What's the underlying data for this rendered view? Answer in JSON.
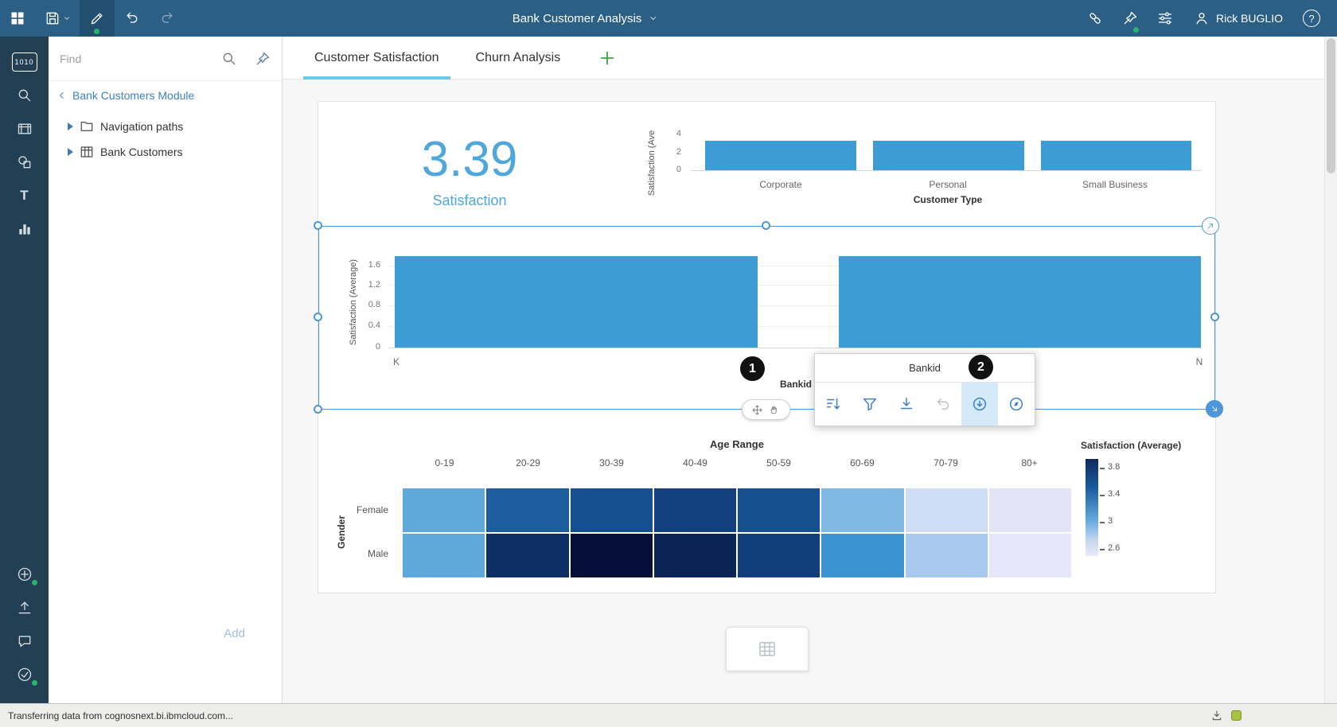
{
  "topbar": {
    "title": "Bank Customer Analysis",
    "user_name": "Rick BUGLIO",
    "help_label": "?"
  },
  "rail": {
    "binary_label": "1010",
    "text_tool_label": "T"
  },
  "panel": {
    "find_placeholder": "Find",
    "breadcrumb": "Bank Customers Module",
    "tree": [
      {
        "label": "Navigation paths"
      },
      {
        "label": "Bank Customers"
      }
    ],
    "add_label": "Add"
  },
  "tabs": {
    "items": [
      {
        "label": "Customer Satisfaction",
        "active": true
      },
      {
        "label": "Churn Analysis",
        "active": false
      }
    ]
  },
  "kpi": {
    "value": "3.39",
    "label": "Satisfaction"
  },
  "callouts": {
    "one": "1",
    "two": "2"
  },
  "popup": {
    "title": "Bankid",
    "tools": [
      "sort",
      "filter",
      "top-bottom",
      "drill-back",
      "drill-down",
      "explore"
    ],
    "active_tool": "drill-down",
    "disabled_tool": "drill-back"
  },
  "statusbar": {
    "text": "Transferring data from cognosnext.bi.ibmcloud.com..."
  },
  "colors": {
    "topbar_bg": "#2C5F86",
    "rail_bg": "#223F54",
    "accent_blue": "#3B7FC6",
    "bar_blue": "#3E9CD4",
    "kpi_blue": "#4FA7DC",
    "tab_underline": "#70C8E9",
    "selection": "#4D96D9",
    "green_dot": "#2AB46B",
    "plus_green": "#41A344"
  },
  "chart_data": [
    {
      "type": "bar",
      "ylabel": "Satisfaction (Ave",
      "xlabel": "Customer Type",
      "yticks": [
        "4",
        "2",
        "0"
      ],
      "ylim": [
        0,
        4
      ],
      "categories": [
        "Corporate",
        "Personal",
        "Small Business"
      ],
      "values": [
        3.3,
        3.35,
        3.3
      ]
    },
    {
      "type": "bar",
      "ylabel": "Satisfaction (Average)",
      "xlabel": "Bankid",
      "yticks": [
        "1.6",
        "1.2",
        "0.8",
        "0.4",
        "0"
      ],
      "ylim": [
        0,
        1.8
      ],
      "categories": [
        "K",
        "N"
      ],
      "values": [
        1.8,
        1.8
      ]
    },
    {
      "type": "heatmap",
      "title": "Age Range",
      "ylabel": "Gender",
      "columns": [
        "0-19",
        "20-29",
        "30-39",
        "40-49",
        "50-59",
        "60-69",
        "70-79",
        "80+"
      ],
      "rows": [
        "Female",
        "Male"
      ],
      "values": [
        [
          3.0,
          3.5,
          3.55,
          3.6,
          3.5,
          2.95,
          2.6,
          2.5
        ],
        [
          3.0,
          3.7,
          3.8,
          3.7,
          3.55,
          3.2,
          2.75,
          2.45
        ]
      ],
      "cell_colors": [
        [
          "#5FA8DC",
          "#1D5C9E",
          "#164F90",
          "#123F7E",
          "#17508F",
          "#7FBAE5",
          "#CEDDF3",
          "#E3E5F7"
        ],
        [
          "#5FA8DC",
          "#0D2F66",
          "#060F38",
          "#0A2458",
          "#123E7B",
          "#3D93D0",
          "#A6C9ED",
          "#E6E7F8"
        ]
      ],
      "legend": {
        "title": "Satisfaction (Average)",
        "ticks": [
          "3.8",
          "3.4",
          "3",
          "2.6"
        ]
      }
    }
  ]
}
